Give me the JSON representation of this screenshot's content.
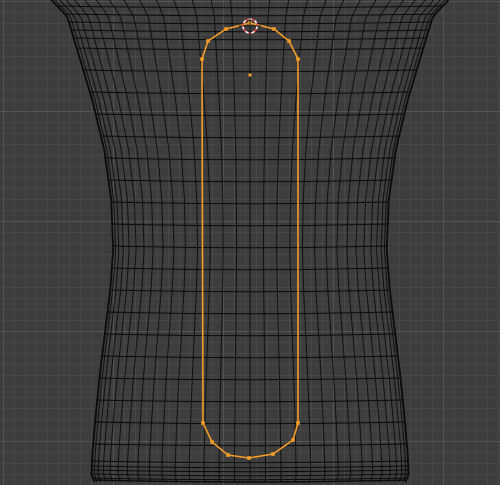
{
  "viewport": {
    "colors": {
      "background": "#3d3d3d",
      "grid_minor": "#474747",
      "grid_major": "#555555",
      "wire": "#0b0b0b",
      "selection": "#f39c26",
      "origin": "#f6a12e",
      "cursor_red": "#e0494b",
      "cursor_white": "#ffffff"
    },
    "icons": {
      "cursor": "3d-cursor-icon",
      "origin": "object-origin-icon"
    },
    "mesh": {
      "name": "vase-wireframe-mesh",
      "shading": "wireframe"
    },
    "selected_object": {
      "name": "rounded-rectangle-curve",
      "vertex_count": 20
    }
  }
}
